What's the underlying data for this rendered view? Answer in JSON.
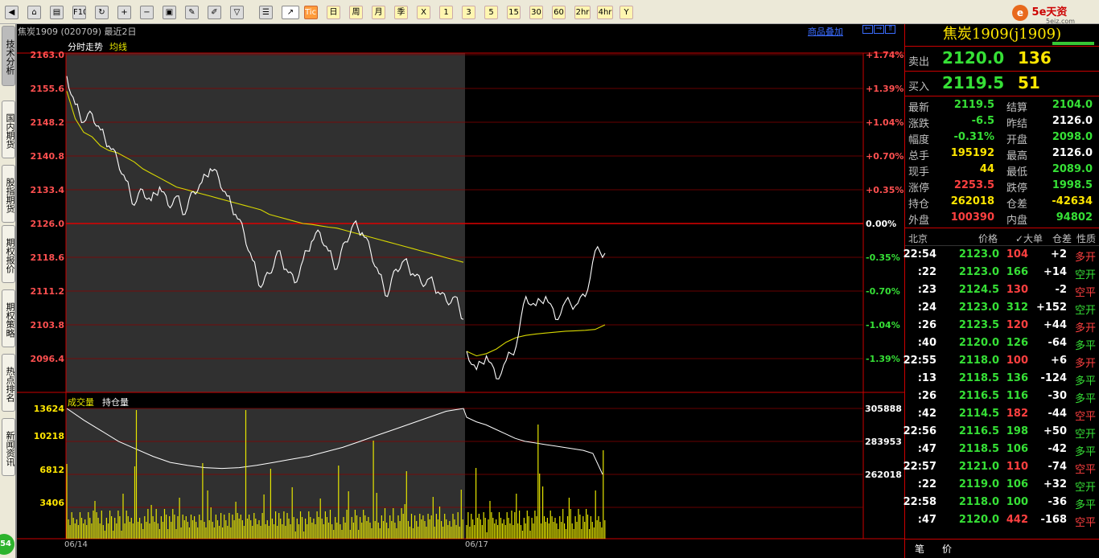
{
  "toolbar": {
    "buttons": [
      {
        "name": "back-icon",
        "label": "◀"
      },
      {
        "name": "home-icon",
        "label": "⌂"
      },
      {
        "name": "notes-icon",
        "label": "▤"
      },
      {
        "name": "f10-icon",
        "label": "F10"
      },
      {
        "name": "refresh-icon",
        "label": "↻"
      },
      {
        "name": "zoom-in-icon",
        "label": "+"
      },
      {
        "name": "zoom-out-icon",
        "label": "−"
      },
      {
        "name": "windows-icon",
        "label": "▣"
      },
      {
        "name": "draw-icon",
        "label": "✎"
      },
      {
        "name": "brush-icon",
        "label": "✐"
      },
      {
        "name": "filter-icon",
        "label": "▽"
      },
      {
        "name": "quote-list-icon",
        "label": "☰"
      },
      {
        "name": "intraday-chart-icon",
        "label": "↗"
      },
      {
        "name": "tick-icon",
        "label": "Tick"
      }
    ],
    "periods": [
      "日",
      "周",
      "月",
      "季",
      "X",
      "1",
      "3",
      "5",
      "15",
      "30",
      "60",
      "2hr",
      "4hr",
      "Y"
    ]
  },
  "brand": {
    "name": "5e天资",
    "domain": "5eiz.com"
  },
  "side_tabs": [
    "技术分析",
    "国内期货",
    "股指期货",
    "期权报价",
    "期权策略",
    "热点排名",
    "新闻资讯"
  ],
  "badge": "54",
  "chart": {
    "title": "焦炭1909 (020709)  最近2日",
    "overlay_link": "商品叠加",
    "nav": [
      "⇐",
      "⇒",
      "⇑"
    ],
    "legend_price": "分时走势",
    "legend_ma": "均线",
    "legend_vol": "成交量",
    "legend_oi": "持仓量",
    "price_labels": [
      "2163.0",
      "2155.6",
      "2148.2",
      "2140.8",
      "2133.4",
      "2126.0",
      "2118.6",
      "2111.2",
      "2103.8",
      "2096.4"
    ],
    "pct_labels": [
      "+1.74%",
      "+1.39%",
      "+1.04%",
      "+0.70%",
      "+0.35%",
      "0.00%",
      "-0.35%",
      "-0.70%",
      "-1.04%",
      "-1.39%"
    ],
    "vol_labels": [
      "13624",
      "10218",
      "6812",
      "3406"
    ],
    "oi_labels": [
      "305888",
      "283953",
      "262018"
    ],
    "dates": [
      "06/14",
      "06/17"
    ]
  },
  "chart_data": {
    "type": "line",
    "title": "焦炭1909 (020709)",
    "prev_settle": 2126.0,
    "ylim": [
      2089.0,
      2163.0
    ],
    "x": [
      "06/14",
      "06/17"
    ],
    "series": [
      {
        "name": "分时走势",
        "values": [
          2158.3,
          2152.1,
          2148.2,
          2150.0,
          2146.5,
          2143.0,
          2140.0,
          2135.5,
          2130.0,
          2133.4,
          2131.0,
          2134.0,
          2130.0,
          2132.0,
          2128.0,
          2133.0,
          2135.0,
          2138.0,
          2136.0,
          2132.0,
          2128.0,
          2124.0,
          2118.0,
          2112.0,
          2115.0,
          2120.0,
          2116.0,
          2113.0,
          2118.0,
          2122.0,
          2124.0,
          2120.0,
          2116.0,
          2122.0,
          2126.0,
          2124.0,
          2120.0,
          2115.0,
          2110.0,
          2116.0,
          2118.0,
          2115.0,
          2113.0,
          2114.0,
          2111.0,
          2109.0,
          2110.0,
          2105.0,
          2098.0,
          2094.0,
          2097.0,
          2092.0,
          2096.0,
          2099.0,
          2110.0,
          2108.0,
          2110.0,
          2105.0,
          2109.0,
          2108.0,
          2110.0,
          2120.0,
          2119.5
        ]
      },
      {
        "name": "均线",
        "values": [
          2155.0,
          2149.0,
          2146.0,
          2145.0,
          2143.0,
          2142.0,
          2141.5,
          2140.5,
          2139.5,
          2138.0,
          2137.0,
          2136.0,
          2135.0,
          2134.0,
          2133.5,
          2133.0,
          2132.5,
          2132.0,
          2131.5,
          2131.0,
          2130.5,
          2130.0,
          2129.5,
          2129.0,
          2128.0,
          2127.5,
          2127.0,
          2126.5,
          2126.0,
          2125.8,
          2125.5,
          2125.2,
          2125.0,
          2124.5,
          2124.0,
          2123.5,
          2123.0,
          2122.5,
          2122.0,
          2121.5,
          2121.0,
          2120.5,
          2120.0,
          2119.5,
          2119.0,
          2118.5,
          2118.0,
          2117.5,
          2098.0,
          2097.0,
          2097.5,
          2098.5,
          2100.0,
          2101.0,
          2101.5,
          2101.8,
          2102.0,
          2102.2,
          2102.4,
          2102.5,
          2102.6,
          2102.8,
          2103.8
        ]
      },
      {
        "name": "持仓量",
        "values": [
          305888,
          298000,
          291000,
          284000,
          279000,
          274000,
          270000,
          268000,
          266500,
          266000,
          266500,
          268000,
          270000,
          272000,
          274000,
          277000,
          280000,
          283953,
          288000,
          292000,
          296000,
          300000,
          304000,
          305888,
          300000,
          297000,
          295000,
          292000,
          289000,
          286000,
          284000,
          283000,
          282000,
          281000,
          280000,
          279000,
          278000,
          276000,
          262018
        ]
      }
    ],
    "volume_peaks": [
      13624,
      10218,
      6812,
      3406
    ]
  },
  "quote": {
    "name": "焦炭1909(j1909)",
    "sell_label": "卖出",
    "sell_price": "2120.0",
    "sell_vol": "136",
    "buy_label": "买入",
    "buy_price": "2119.5",
    "buy_vol": "51",
    "stats": [
      {
        "l1": "最新",
        "v1": "2119.5",
        "c1": "#36e036",
        "l2": "结算",
        "v2": "2104.0",
        "c2": "#36e036"
      },
      {
        "l1": "涨跌",
        "v1": "-6.5",
        "c1": "#36e036",
        "l2": "昨结",
        "v2": "2126.0",
        "c2": "#ffffff"
      },
      {
        "l1": "幅度",
        "v1": "-0.31%",
        "c1": "#36e036",
        "l2": "开盘",
        "v2": "2098.0",
        "c2": "#36e036"
      },
      {
        "l1": "总手",
        "v1": "195192",
        "c1": "#ffe600",
        "l2": "最高",
        "v2": "2126.0",
        "c2": "#ffffff"
      },
      {
        "l1": "现手",
        "v1": "44",
        "c1": "#ffe600",
        "l2": "最低",
        "v2": "2089.0",
        "c2": "#36e036"
      },
      {
        "l1": "涨停",
        "v1": "2253.5",
        "c1": "#ff4040",
        "l2": "跌停",
        "v2": "1998.5",
        "c2": "#36e036"
      },
      {
        "l1": "持仓",
        "v1": "262018",
        "c1": "#ffe600",
        "l2": "仓差",
        "v2": "-42634",
        "c2": "#ffe600"
      },
      {
        "l1": "外盘",
        "v1": "100390",
        "c1": "#ff4040",
        "l2": "内盘",
        "v2": "94802",
        "c2": "#36e036"
      }
    ],
    "table_headers": [
      "北京",
      "价格",
      "✓大单",
      "仓差",
      "性质"
    ],
    "ticks": [
      {
        "time": "22:54",
        "price": "2123.0",
        "vol": "104",
        "diff": "+2",
        "nature": "多开",
        "pc": "#36e036",
        "vc": "#ff4040",
        "nc": "#ff4040"
      },
      {
        "time": ":22",
        "price": "2123.0",
        "vol": "166",
        "diff": "+14",
        "nature": "空开",
        "pc": "#36e036",
        "vc": "#36e036",
        "nc": "#36e036"
      },
      {
        "time": ":23",
        "price": "2124.5",
        "vol": "130",
        "diff": "-2",
        "nature": "空平",
        "pc": "#36e036",
        "vc": "#ff4040",
        "nc": "#ff4040"
      },
      {
        "time": ":24",
        "price": "2123.0",
        "vol": "312",
        "diff": "+152",
        "nature": "空开",
        "pc": "#36e036",
        "vc": "#36e036",
        "nc": "#36e036"
      },
      {
        "time": ":26",
        "price": "2123.5",
        "vol": "120",
        "diff": "+44",
        "nature": "多开",
        "pc": "#36e036",
        "vc": "#ff4040",
        "nc": "#ff4040"
      },
      {
        "time": ":40",
        "price": "2120.0",
        "vol": "126",
        "diff": "-64",
        "nature": "多平",
        "pc": "#36e036",
        "vc": "#36e036",
        "nc": "#36e036"
      },
      {
        "time": "22:55",
        "price": "2118.0",
        "vol": "100",
        "diff": "+6",
        "nature": "多开",
        "pc": "#36e036",
        "vc": "#ff4040",
        "nc": "#ff4040"
      },
      {
        "time": ":13",
        "price": "2118.5",
        "vol": "136",
        "diff": "-124",
        "nature": "多平",
        "pc": "#36e036",
        "vc": "#36e036",
        "nc": "#36e036"
      },
      {
        "time": ":26",
        "price": "2116.5",
        "vol": "116",
        "diff": "-30",
        "nature": "多平",
        "pc": "#36e036",
        "vc": "#36e036",
        "nc": "#36e036"
      },
      {
        "time": ":42",
        "price": "2114.5",
        "vol": "182",
        "diff": "-44",
        "nature": "空平",
        "pc": "#36e036",
        "vc": "#ff4040",
        "nc": "#ff4040"
      },
      {
        "time": "22:56",
        "price": "2116.5",
        "vol": "198",
        "diff": "+50",
        "nature": "空开",
        "pc": "#36e036",
        "vc": "#36e036",
        "nc": "#36e036"
      },
      {
        "time": ":47",
        "price": "2118.5",
        "vol": "106",
        "diff": "-42",
        "nature": "多平",
        "pc": "#36e036",
        "vc": "#36e036",
        "nc": "#36e036"
      },
      {
        "time": "22:57",
        "price": "2121.0",
        "vol": "110",
        "diff": "-74",
        "nature": "空平",
        "pc": "#36e036",
        "vc": "#ff4040",
        "nc": "#ff4040"
      },
      {
        "time": ":22",
        "price": "2119.0",
        "vol": "106",
        "diff": "+32",
        "nature": "空开",
        "pc": "#36e036",
        "vc": "#36e036",
        "nc": "#36e036"
      },
      {
        "time": "22:58",
        "price": "2118.0",
        "vol": "100",
        "diff": "-36",
        "nature": "多平",
        "pc": "#36e036",
        "vc": "#36e036",
        "nc": "#36e036"
      },
      {
        "time": ":47",
        "price": "2120.0",
        "vol": "442",
        "diff": "-168",
        "nature": "空平",
        "pc": "#36e036",
        "vc": "#ff4040",
        "nc": "#ff4040"
      }
    ],
    "tabs": [
      "笔",
      "价"
    ]
  }
}
